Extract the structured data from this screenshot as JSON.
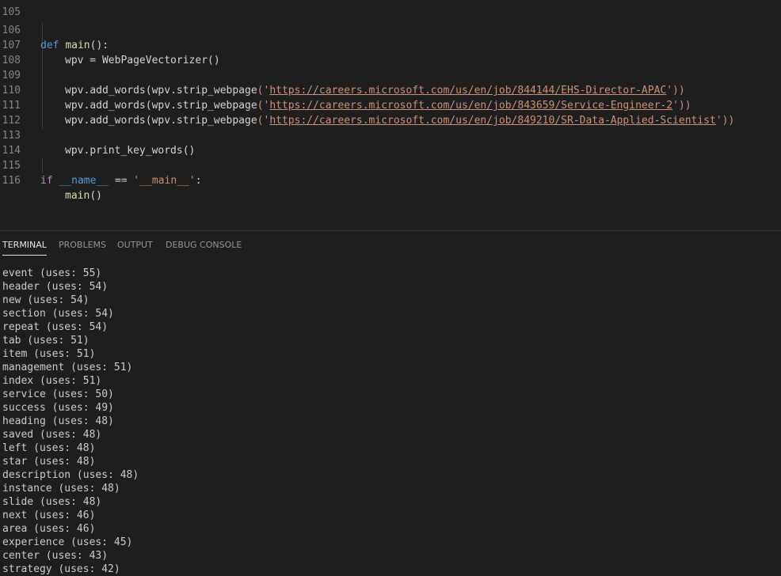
{
  "editor": {
    "line_partial": "105",
    "lines": [
      {
        "n": "106"
      },
      {
        "n": "107"
      },
      {
        "n": "108"
      },
      {
        "n": "109"
      },
      {
        "n": "110"
      },
      {
        "n": "111"
      },
      {
        "n": "112"
      },
      {
        "n": "113"
      },
      {
        "n": "114"
      },
      {
        "n": "115"
      },
      {
        "n": "116"
      }
    ],
    "code": {
      "def_kw": "def",
      "main_fn": "main",
      "main_sig": "():",
      "wpv_assign": "wpv = ",
      "vectorizer": "WebPageVectorizer",
      "call_parens": "()",
      "wpv_prefix": "wpv.",
      "add_words": "add_words",
      "strip_open": "(wpv.",
      "strip_webpage": "strip_webpage",
      "quote_open": "('",
      "quote_close": "'))",
      "url1": "https://careers.microsoft.com/us/en/job/844144/EHS-Director-APAC",
      "url2": "https://careers.microsoft.com/us/en/job/843659/Service-Engineer-2",
      "url3": "https://careers.microsoft.com/us/en/job/849210/SR-Data-Applied-Scientist",
      "print_key_words": "print_key_words",
      "if_kw": "if",
      "name_var": "__name__",
      "eq": " == ",
      "main_str": "'__main__'",
      "colon": ":",
      "main_call": "main"
    }
  },
  "panel": {
    "tabs": [
      {
        "label": "TERMINAL"
      },
      {
        "label": "PROBLEMS"
      },
      {
        "label": "OUTPUT"
      },
      {
        "label": "DEBUG CONSOLE"
      }
    ],
    "terminal_lines": [
      "event (uses: 55)",
      "header (uses: 54)",
      "new (uses: 54)",
      "section (uses: 54)",
      "repeat (uses: 54)",
      "tab (uses: 51)",
      "item (uses: 51)",
      "management (uses: 51)",
      "index (uses: 51)",
      "service (uses: 50)",
      "success (uses: 49)",
      "heading (uses: 48)",
      "saved (uses: 48)",
      "left (uses: 48)",
      "star (uses: 48)",
      "description (uses: 48)",
      "instance (uses: 48)",
      "slide (uses: 48)",
      "next (uses: 46)",
      "area (uses: 46)",
      "experience (uses: 45)",
      "center (uses: 43)",
      "strategy (uses: 42)"
    ]
  },
  "colors": {
    "background": "#1e1e1e",
    "keyword_blue": "#569cd6",
    "keyword_purple": "#c586c0",
    "function": "#dcdcaa",
    "string": "#ce9178",
    "variable": "#9cdcfe"
  }
}
